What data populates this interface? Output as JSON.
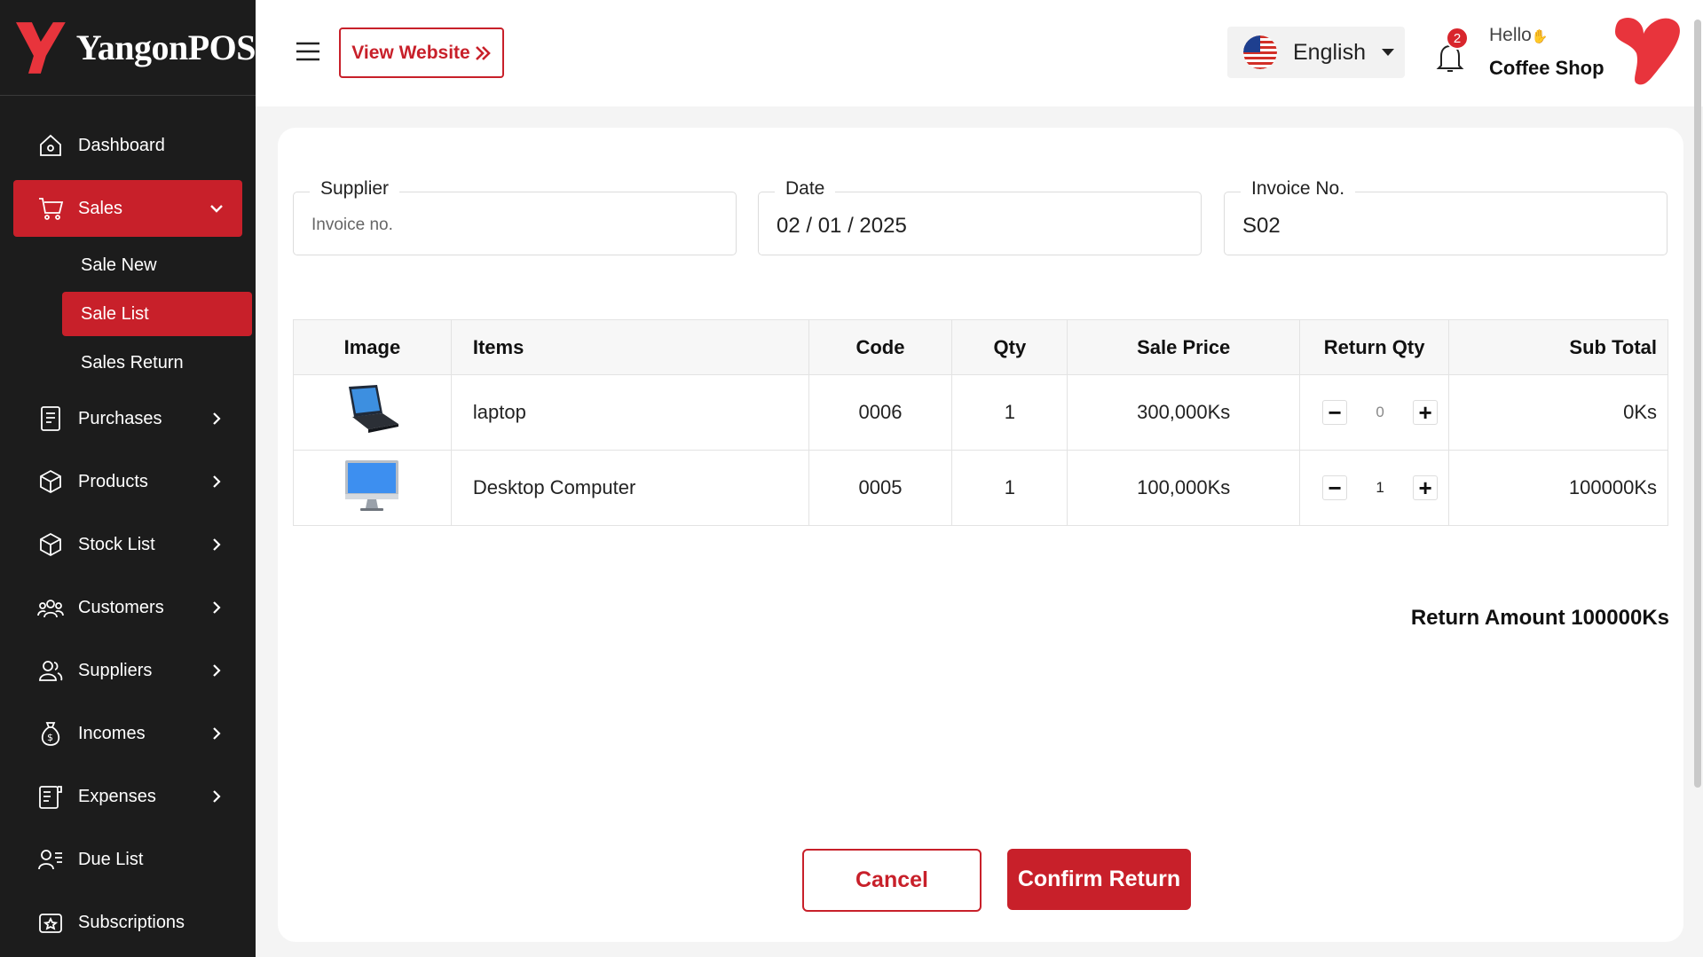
{
  "brand": {
    "name": "YangonPOS",
    "accent": "#c8202a"
  },
  "header": {
    "view_website": "View Website",
    "language": "English",
    "notification_count": "2",
    "hello": "Hello",
    "shop_name": "Coffee Shop"
  },
  "sidebar": {
    "items": [
      {
        "label": "Dashboard",
        "icon": "home-icon"
      },
      {
        "label": "Sales",
        "icon": "cart-icon"
      },
      {
        "label": "Purchases",
        "icon": "receipt-icon"
      },
      {
        "label": "Products",
        "icon": "box-icon"
      },
      {
        "label": "Stock List",
        "icon": "box-icon"
      },
      {
        "label": "Customers",
        "icon": "users-icon"
      },
      {
        "label": "Suppliers",
        "icon": "user-group-icon"
      },
      {
        "label": "Incomes",
        "icon": "money-bag-icon"
      },
      {
        "label": "Expenses",
        "icon": "invoice-icon"
      },
      {
        "label": "Due List",
        "icon": "user-list-icon"
      },
      {
        "label": "Subscriptions",
        "icon": "subscription-icon"
      }
    ],
    "sales_sub": [
      "Sale New",
      "Sale List",
      "Sales Return"
    ]
  },
  "form": {
    "supplier_label": "Supplier",
    "supplier_placeholder": "Invoice no.",
    "date_label": "Date",
    "date_value": "02 / 01 / 2025",
    "invoice_label": "Invoice No.",
    "invoice_value": "S02"
  },
  "table": {
    "headers": [
      "Image",
      "Items",
      "Code",
      "Qty",
      "Sale Price",
      "Return Qty",
      "Sub Total"
    ],
    "rows": [
      {
        "image": "laptop-icon",
        "item": "laptop",
        "code": "0006",
        "qty": "1",
        "price": "300,000Ks",
        "return_qty": "0",
        "sub_total": "0Ks"
      },
      {
        "image": "desktop-icon",
        "item": "Desktop Computer",
        "code": "0005",
        "qty": "1",
        "price": "100,000Ks",
        "return_qty": "1",
        "sub_total": "100000Ks"
      }
    ]
  },
  "summary": {
    "return_amount": "Return Amount 100000Ks"
  },
  "actions": {
    "cancel": "Cancel",
    "confirm": "Confirm Return"
  }
}
